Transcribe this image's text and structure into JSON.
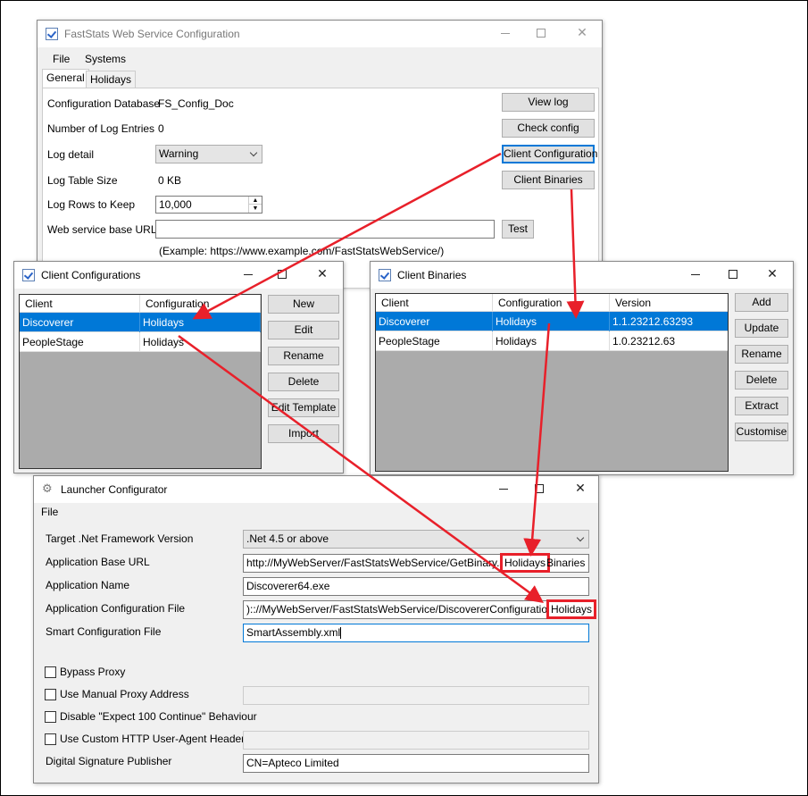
{
  "main_window": {
    "title": "FastStats Web Service Configuration",
    "menu": [
      "File",
      "Systems"
    ],
    "tabs": [
      "General",
      "Holidays"
    ],
    "fields": {
      "config_db_label": "Configuration Database",
      "config_db_value": "FS_Config_Doc",
      "num_log_label": "Number of Log Entries",
      "num_log_value": "0",
      "log_detail_label": "Log detail",
      "log_detail_value": "Warning",
      "log_table_label": "Log Table Size",
      "log_table_value": "0 KB",
      "log_rows_label": "Log Rows to Keep",
      "log_rows_value": "10,000",
      "base_url_label": "Web service base URL",
      "base_url_value": "",
      "example_text": "(Example: https://www.example.com/FastStatsWebService/)"
    },
    "buttons": {
      "view_log": "View log",
      "check_config": "Check config",
      "client_configuration": "Client Configuration",
      "client_binaries": "Client Binaries",
      "test": "Test"
    }
  },
  "client_configurations": {
    "title": "Client Configurations",
    "columns": [
      "Client",
      "Configuration"
    ],
    "rows": [
      {
        "client": "Discoverer",
        "configuration": "Holidays",
        "selected": true
      },
      {
        "client": "PeopleStage",
        "configuration": "Holidays",
        "selected": false
      }
    ],
    "buttons": [
      "New",
      "Edit",
      "Rename",
      "Delete",
      "Edit Template",
      "Import"
    ]
  },
  "client_binaries": {
    "title": "Client Binaries",
    "columns": [
      "Client",
      "Configuration",
      "Version"
    ],
    "rows": [
      {
        "client": "Discoverer",
        "configuration": "Holidays",
        "version": "1.1.23212.63293",
        "selected": true
      },
      {
        "client": "PeopleStage",
        "configuration": "Holidays",
        "version": "1.0.23212.63",
        "selected": false
      }
    ],
    "buttons": [
      "Add",
      "Update",
      "Rename",
      "Delete",
      "Extract",
      "Customise"
    ]
  },
  "launcher": {
    "title": "Launcher Configurator",
    "menu": [
      "File"
    ],
    "fields": {
      "framework_label": "Target .Net Framework Version",
      "framework_value": ".Net 4.5 or above",
      "base_url_label": "Application Base URL",
      "base_url_value": "http://MyWebServer/FastStatsWebService/GetBinary.aspx",
      "base_url_highlight": "Holidays",
      "base_url_suffix": "Binaries",
      "app_name_label": "Application Name",
      "app_name_value": "Discoverer64.exe",
      "app_config_label": "Application Configuration File",
      "app_config_value": "):://MyWebServer/FastStatsWebService/DiscovererConfiguration.aspx",
      "app_config_highlight": "Holidays",
      "smart_config_label": "Smart Configuration File",
      "smart_config_value": "SmartAssembly.xml",
      "bypass_proxy": "Bypass Proxy",
      "manual_proxy": "Use Manual Proxy Address",
      "expect100": "Disable \"Expect 100 Continue\" Behaviour",
      "custom_agent": "Use Custom HTTP User-Agent Header",
      "signature_label": "Digital Signature Publisher",
      "signature_value": "CN=Apteco Limited"
    }
  },
  "colors": {
    "selection": "#0078d7",
    "annotation_red": "#e8202a"
  },
  "icons": [
    "app-check-icon",
    "minimize-icon",
    "maximize-icon",
    "close-icon",
    "chevron-down-icon",
    "spinner-up-icon",
    "spinner-down-icon",
    "gear-icon"
  ]
}
